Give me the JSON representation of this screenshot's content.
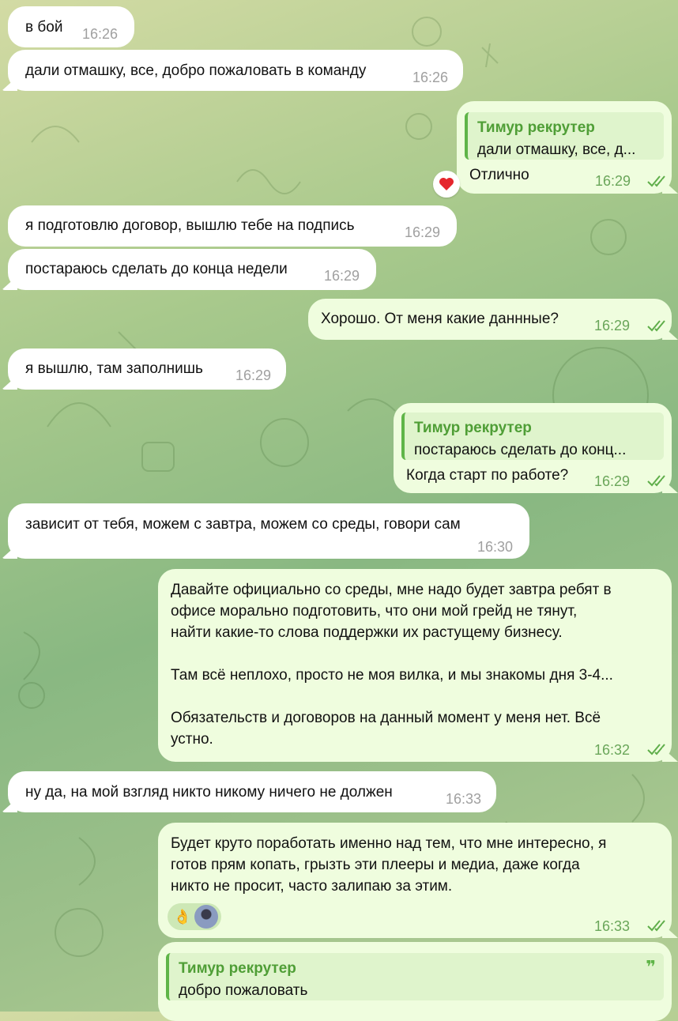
{
  "messages": [
    {
      "text": "в бой",
      "time": "16:26"
    },
    {
      "text": "дали отмашку, все, добро пожаловать в команду",
      "time": "16:26"
    },
    {
      "reply_name": "Тимур рекрутер",
      "reply_text": "дали отмашку, все, д...",
      "text": "Отлично",
      "time": "16:29",
      "reaction": "❤️"
    },
    {
      "text": "я подготовлю договор, вышлю тебе на подпись",
      "time": "16:29"
    },
    {
      "text": "постараюсь сделать до конца недели",
      "time": "16:29"
    },
    {
      "text": "Хорошо. От меня какие даннные?",
      "time": "16:29"
    },
    {
      "text": "я вышлю, там заполнишь",
      "time": "16:29"
    },
    {
      "reply_name": "Тимур рекрутер",
      "reply_text": "постараюсь сделать до конц...",
      "text": "Когда старт по работе?",
      "time": "16:29"
    },
    {
      "text": "зависит от тебя, можем с завтра, можем со среды, говори сам",
      "time": "16:30"
    },
    {
      "lines": [
        "Давайте официально со среды, мне надо будет завтра ребят в",
        "офисе морально подготовить, что они мой грейд не тянут,",
        "найти какие-то слова поддержки их растущему бизнесу.",
        "",
        "Там всё неплохо, просто не моя вилка, и мы знакомы дня 3-4...",
        "",
        "Обязательств и договоров на данный момент у меня нет. Всё",
        "устно."
      ],
      "time": "16:32"
    },
    {
      "text": "ну да, на мой взгляд никто никому ничего не должен",
      "time": "16:33"
    },
    {
      "lines": [
        "Будет круто поработать именно над тем, что мне интересно, я",
        "готов прям копать, грызть эти плееры и медиа, даже когда",
        "никто не просит, часто залипаю за этим."
      ],
      "reactions": [
        "👌",
        "avatar"
      ],
      "time": "16:33"
    },
    {
      "reply_name": "Тимур рекрутер",
      "reply_text": "добро пожаловать",
      "quote_icon": "❞"
    }
  ]
}
